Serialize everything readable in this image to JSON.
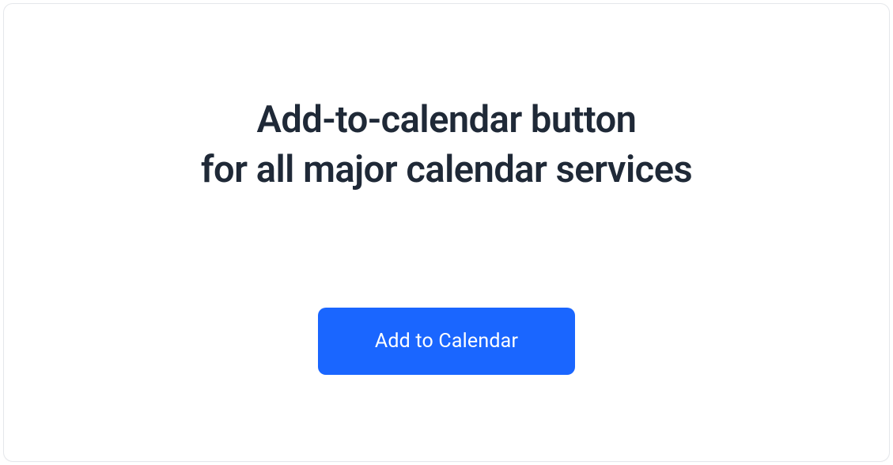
{
  "heading": {
    "line1": "Add-to-calendar button",
    "line2": "for all major calendar services"
  },
  "button": {
    "label": "Add to Calendar"
  },
  "colors": {
    "primary": "#1a66ff",
    "text": "#1f2937",
    "border": "#e5e7eb"
  }
}
